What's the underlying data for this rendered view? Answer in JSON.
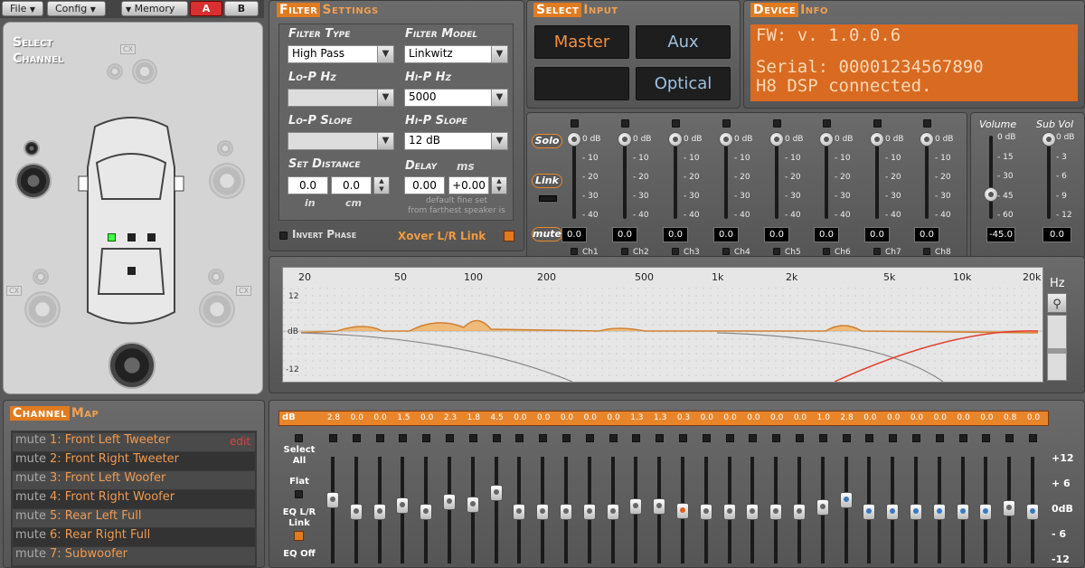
{
  "menu": {
    "file": "File",
    "config": "Config",
    "memory": "Memory",
    "mem_a": "A",
    "mem_b": "B"
  },
  "select_channel": {
    "title_line1": "Select",
    "title_line2": "Channel"
  },
  "filter": {
    "title_hl": "Filter",
    "title_rest": "Settings",
    "filter_type_label": "Filter Type",
    "filter_type_value": "High Pass",
    "filter_model_label": "Filter Model",
    "filter_model_value": "Linkwitz",
    "lop_hz_label": "Lo-P  Hz",
    "lop_hz_value": "",
    "hip_hz_label": "Hi-P  Hz",
    "hip_hz_value": "5000",
    "lop_slope_label": "Lo-P Slope",
    "lop_slope_value": "",
    "hip_slope_label": "Hi-P Slope",
    "hip_slope_value": "12 dB",
    "set_distance_label": "Set Distance",
    "dist_in": "0.0",
    "dist_cm": "0.0",
    "unit_in": "in",
    "unit_cm": "cm",
    "delay_label": "Delay",
    "delay_unit": "ms",
    "delay_default": "0.00",
    "delay_fine": "+0.00",
    "delay_note1": "default    fine set",
    "delay_note2": "from farthest speaker is",
    "invert_phase": "Invert Phase",
    "xover_link": "Xover L/R Link"
  },
  "input": {
    "title_hl": "Select",
    "title_rest": "Input",
    "master": "Master",
    "aux": "Aux",
    "optical": "Optical"
  },
  "device": {
    "title_hl": "Device",
    "title_rest": "Info",
    "fw": "FW: v. 1.0.0.6",
    "serial": "Serial: 00001234567890",
    "status": "H8 DSP connected."
  },
  "mixer": {
    "solo": "Solo",
    "link": "Link",
    "mute": "mute",
    "ticks": [
      "0 dB",
      "- 10",
      "- 20",
      "- 30",
      "- 40"
    ],
    "channels": [
      "Ch1",
      "Ch2",
      "Ch3",
      "Ch4",
      "Ch5",
      "Ch6",
      "Ch7",
      "Ch8"
    ],
    "values": [
      "0.0",
      "0.0",
      "0.0",
      "0.0",
      "0.0",
      "0.0",
      "0.0",
      "0.0"
    ]
  },
  "volume": {
    "label": "Volume",
    "sub_label": "Sub Vol",
    "vol_ticks": [
      "0 dB",
      "- 15",
      "- 30",
      "- 45",
      "- 60"
    ],
    "sub_ticks": [
      "0 dB",
      "- 3",
      "- 6",
      "- 9",
      "- 12"
    ],
    "vol_value": "-45.0",
    "sub_value": "0.0"
  },
  "graph": {
    "freq_ticks": [
      "20",
      "50",
      "100",
      "200",
      "500",
      "1k",
      "2k",
      "5k",
      "10k",
      "20k"
    ],
    "hz": "Hz",
    "y_top": "12",
    "y_mid": "dB",
    "y_bot": "-12"
  },
  "channel_map": {
    "title_hl": "Channel",
    "title_rest": "Map",
    "edit": "edit",
    "rows": [
      {
        "mute": "mute",
        "name": "1: Front Left Tweeter"
      },
      {
        "mute": "mute",
        "name": "2: Front Right Tweeter"
      },
      {
        "mute": "mute",
        "name": "3: Front Left Woofer"
      },
      {
        "mute": "mute",
        "name": "4: Front Right Woofer"
      },
      {
        "mute": "mute",
        "name": "5: Rear Left Full"
      },
      {
        "mute": "mute",
        "name": "6: Rear Right Full"
      },
      {
        "mute": "mute",
        "name": "7: Subwoofer"
      }
    ]
  },
  "eq": {
    "db_label": "dB",
    "values": [
      "2.8",
      "0.0",
      "0.0",
      "1.5",
      "0.0",
      "2.3",
      "1.8",
      "4.5",
      "0.0",
      "0.0",
      "0.0",
      "0.0",
      "0.0",
      "1.3",
      "1.3",
      "0.3",
      "0.0",
      "0.0",
      "0.0",
      "0.0",
      "0.0",
      "1.0",
      "2.8",
      "0.0",
      "0.0",
      "0.0",
      "0.0",
      "0.0",
      "0.0",
      "0.8",
      "0.0"
    ],
    "select_all": "Select All",
    "flat": "Flat",
    "eq_lr_link": "EQ L/R Link",
    "eq_off": "EQ Off",
    "scale": [
      "+12",
      "+ 6",
      "0dB",
      "- 6",
      "-12"
    ]
  },
  "colors": {
    "accent": "#e07b1f",
    "panel": "#5a5a5a",
    "lcd": "#d86a22"
  }
}
